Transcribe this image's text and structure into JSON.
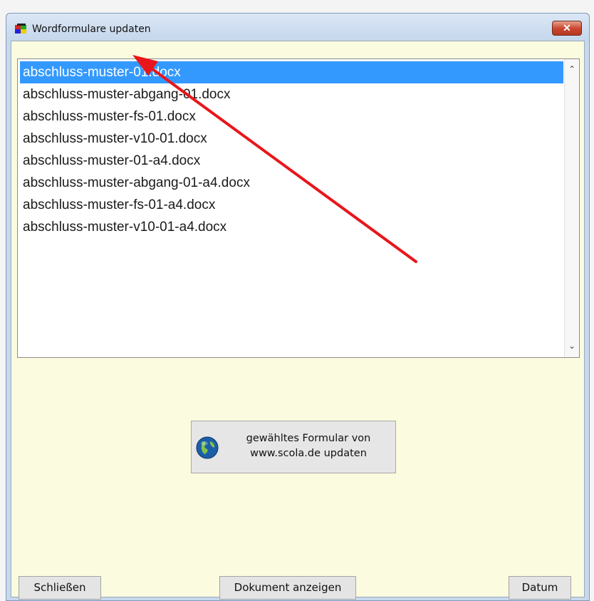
{
  "window": {
    "title": "Wordformulare updaten",
    "close_label": "✕"
  },
  "file_list": {
    "items": [
      {
        "label": "abschluss-muster-01.docx",
        "selected": true
      },
      {
        "label": "abschluss-muster-abgang-01.docx",
        "selected": false
      },
      {
        "label": "abschluss-muster-fs-01.docx",
        "selected": false
      },
      {
        "label": "abschluss-muster-v10-01.docx",
        "selected": false
      },
      {
        "label": "abschluss-muster-01-a4.docx",
        "selected": false
      },
      {
        "label": "abschluss-muster-abgang-01-a4.docx",
        "selected": false
      },
      {
        "label": "abschluss-muster-fs-01-a4.docx",
        "selected": false
      },
      {
        "label": "abschluss-muster-v10-01-a4.docx",
        "selected": false
      }
    ],
    "scroll_up": "⌃",
    "scroll_down": "⌄"
  },
  "update_button": {
    "line1": "gewähltes Formular von",
    "line2": "www.scola.de updaten",
    "icon": "globe-icon"
  },
  "footer": {
    "close_label": "Schließen",
    "document_label": "Dokument anzeigen",
    "date_label": "Datum"
  },
  "colors": {
    "selection": "#3399ff",
    "client_background": "#fbfbdf",
    "annotation_arrow": "#e8161b"
  }
}
